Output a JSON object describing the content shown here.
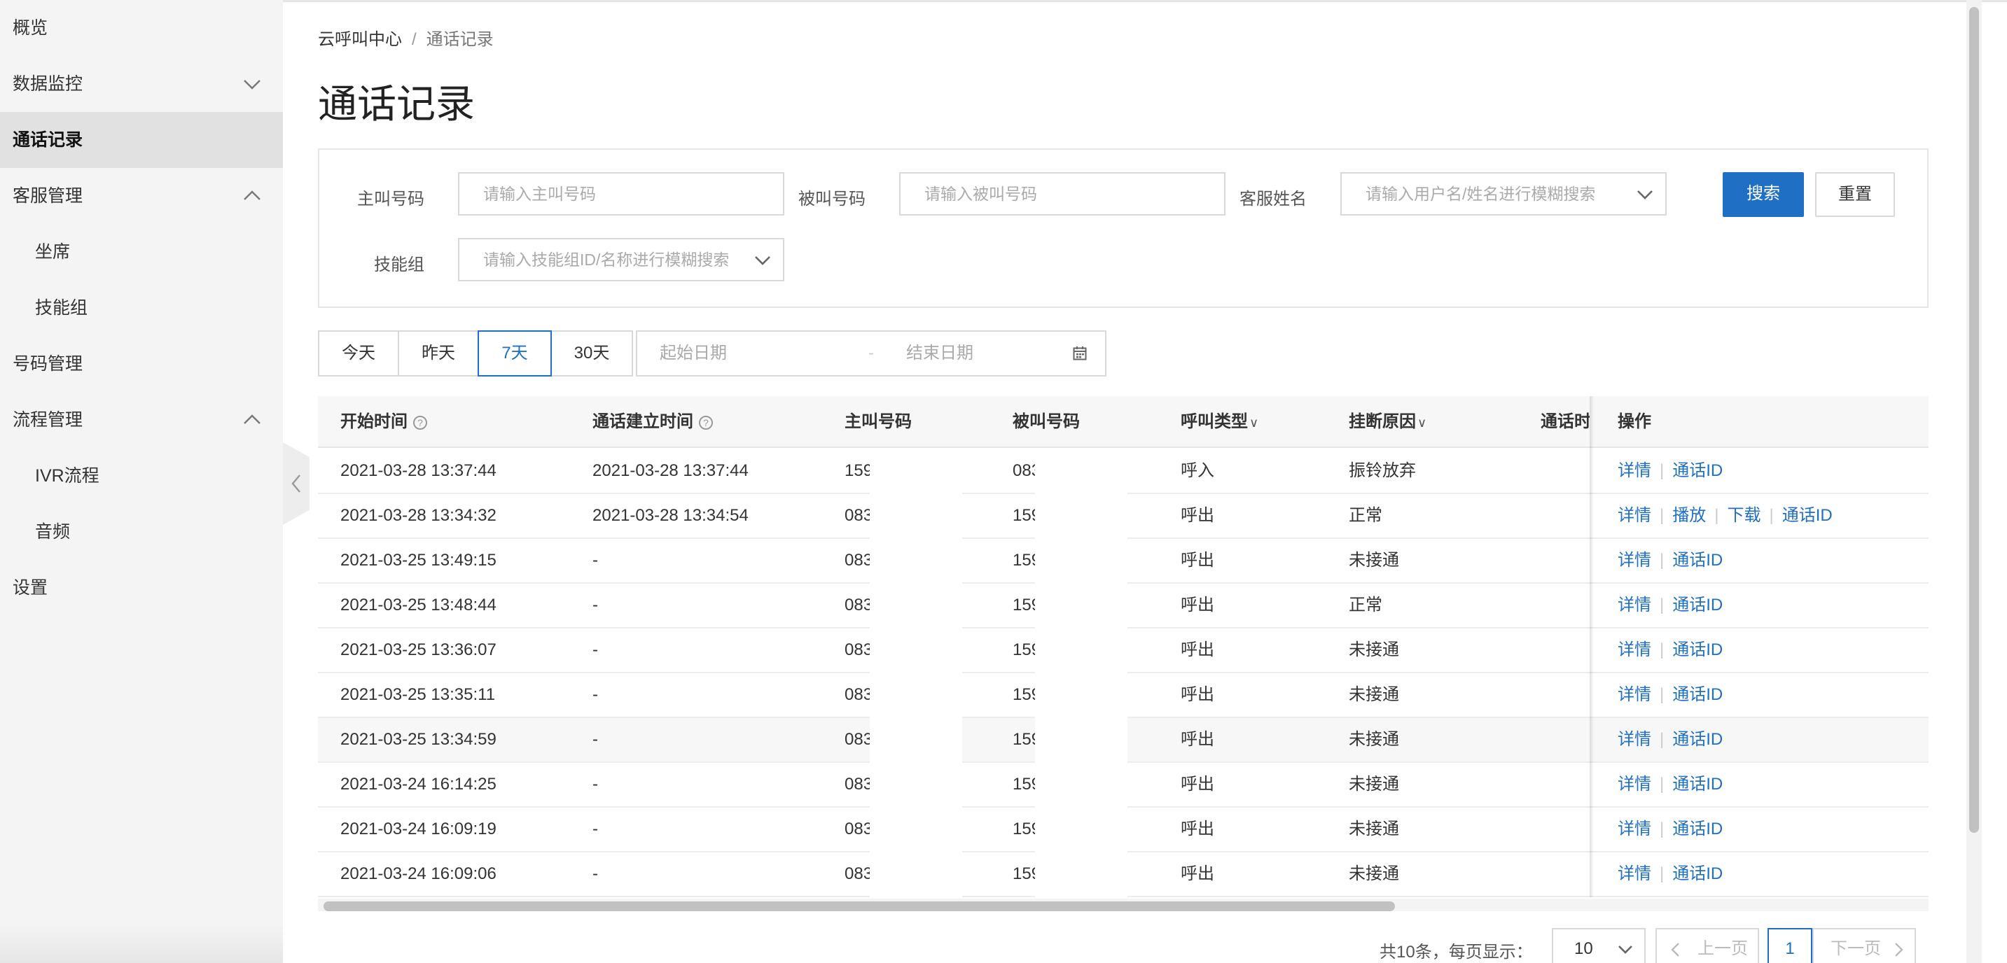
{
  "sidebar": {
    "items": [
      {
        "label": "概览"
      },
      {
        "label": "数据监控"
      },
      {
        "label": "通话记录"
      },
      {
        "label": "客服管理"
      },
      {
        "label": "坐席"
      },
      {
        "label": "技能组"
      },
      {
        "label": "号码管理"
      },
      {
        "label": "流程管理"
      },
      {
        "label": "IVR流程"
      },
      {
        "label": "音频"
      },
      {
        "label": "设置"
      }
    ]
  },
  "breadcrumb": {
    "root": "云呼叫中心",
    "separator": "/",
    "current": "通话记录"
  },
  "page_title": "通话记录",
  "filters": {
    "caller_label": "主叫号码",
    "caller_placeholder": "请输入主叫号码",
    "callee_label": "被叫号码",
    "callee_placeholder": "请输入被叫号码",
    "agent_label": "客服姓名",
    "agent_placeholder": "请输入用户名/姓名进行模糊搜索",
    "skill_label": "技能组",
    "skill_placeholder": "请输入技能组ID/名称进行模糊搜索",
    "search_label": "搜索",
    "reset_label": "重置"
  },
  "date_filter": {
    "quick": [
      "今天",
      "昨天",
      "7天",
      "30天"
    ],
    "active": "7天",
    "start_placeholder": "起始日期",
    "range_sep": "-",
    "end_placeholder": "结束日期"
  },
  "table": {
    "columns": {
      "start_time": "开始时间",
      "connect_time": "通话建立时间",
      "caller": "主叫号码",
      "callee": "被叫号码",
      "call_type": "呼叫类型",
      "hangup_reason": "挂断原因",
      "duration": "通话时长",
      "ops": "操作"
    },
    "rows": [
      {
        "start": "2021-03-28 13:37:44",
        "connect": "2021-03-28 13:37:44",
        "caller": "159",
        "callee": "083",
        "type": "呼入",
        "reason": "振铃放弃",
        "ops": [
          "详情",
          "通话ID"
        ]
      },
      {
        "start": "2021-03-28 13:34:32",
        "connect": "2021-03-28 13:34:54",
        "caller": "083",
        "callee": "159",
        "type": "呼出",
        "reason": "正常",
        "ops": [
          "详情",
          "播放",
          "下载",
          "通话ID"
        ]
      },
      {
        "start": "2021-03-25 13:49:15",
        "connect": "-",
        "caller": "083",
        "callee": "159",
        "type": "呼出",
        "reason": "未接通",
        "ops": [
          "详情",
          "通话ID"
        ]
      },
      {
        "start": "2021-03-25 13:48:44",
        "connect": "-",
        "caller": "083",
        "callee": "159",
        "type": "呼出",
        "reason": "正常",
        "ops": [
          "详情",
          "通话ID"
        ]
      },
      {
        "start": "2021-03-25 13:36:07",
        "connect": "-",
        "caller": "083",
        "callee": "159",
        "type": "呼出",
        "reason": "未接通",
        "ops": [
          "详情",
          "通话ID"
        ]
      },
      {
        "start": "2021-03-25 13:35:11",
        "connect": "-",
        "caller": "083",
        "callee": "159",
        "type": "呼出",
        "reason": "未接通",
        "ops": [
          "详情",
          "通话ID"
        ]
      },
      {
        "start": "2021-03-25 13:34:59",
        "connect": "-",
        "caller": "083",
        "callee": "159",
        "type": "呼出",
        "reason": "未接通",
        "ops": [
          "详情",
          "通话ID"
        ]
      },
      {
        "start": "2021-03-24 16:14:25",
        "connect": "-",
        "caller": "083",
        "callee": "159",
        "type": "呼出",
        "reason": "未接通",
        "ops": [
          "详情",
          "通话ID"
        ]
      },
      {
        "start": "2021-03-24 16:09:19",
        "connect": "-",
        "caller": "083",
        "callee": "159",
        "type": "呼出",
        "reason": "未接通",
        "ops": [
          "详情",
          "通话ID"
        ]
      },
      {
        "start": "2021-03-24 16:09:06",
        "connect": "-",
        "caller": "083",
        "callee": "159",
        "type": "呼出",
        "reason": "未接通",
        "ops": [
          "详情",
          "通话ID"
        ]
      }
    ]
  },
  "pagination": {
    "total_text": "共10条，每页显示：",
    "page_size": "10",
    "prev_label": "上一页",
    "current_page": "1",
    "next_label": "下一页"
  },
  "colors": {
    "primary": "#1f6fc5",
    "sidebar_bg": "#f4f4f5",
    "active_bg": "#e1e1e1"
  }
}
